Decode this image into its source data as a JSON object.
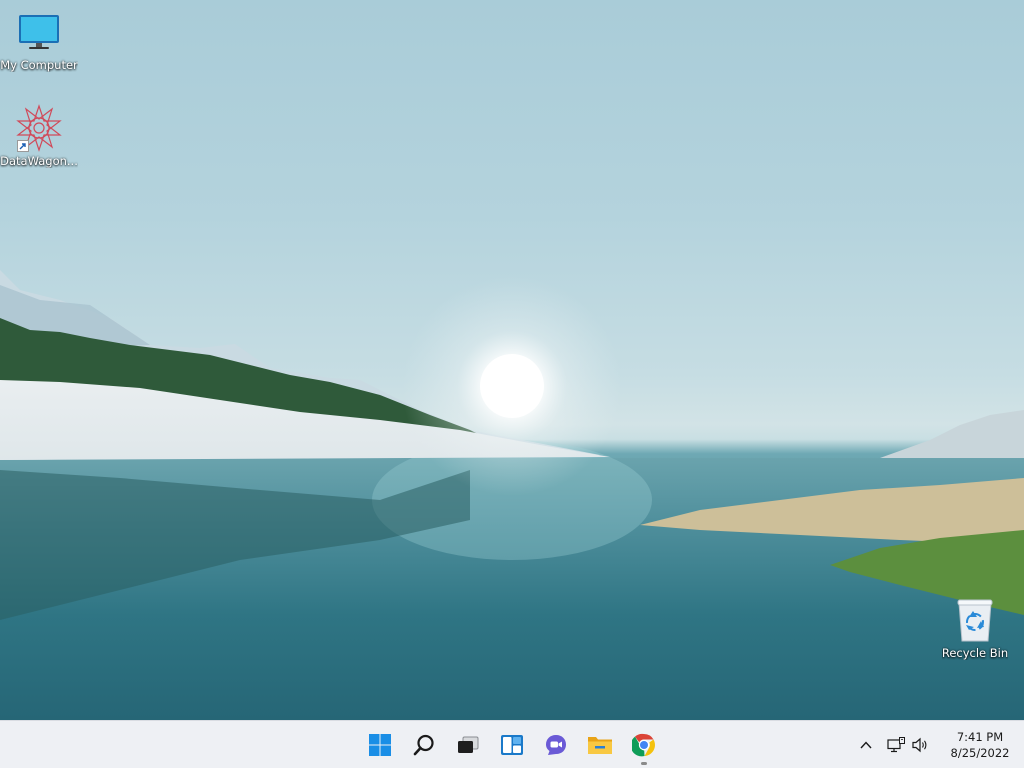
{
  "desktop": {
    "icons": [
      {
        "label": "My Computer",
        "icon": "monitor-icon"
      },
      {
        "label": "DataWagon...",
        "icon": "datawagon-logo-icon"
      },
      {
        "label": "Recycle Bin",
        "icon": "recycle-bin-icon"
      }
    ]
  },
  "taskbar": {
    "apps": [
      {
        "name": "Start",
        "icon": "windows-start-icon"
      },
      {
        "name": "Search",
        "icon": "search-icon"
      },
      {
        "name": "Task View",
        "icon": "task-view-icon"
      },
      {
        "name": "Widgets",
        "icon": "widgets-icon"
      },
      {
        "name": "Chat",
        "icon": "chat-icon"
      },
      {
        "name": "File Explorer",
        "icon": "folder-icon"
      },
      {
        "name": "Google Chrome",
        "icon": "chrome-icon"
      }
    ],
    "tray": {
      "icons": [
        "chevron-up-icon",
        "network-icon",
        "volume-icon"
      ],
      "time": "7:41 PM",
      "date": "8/25/2022"
    }
  },
  "colors": {
    "taskbar_bg": "#eef0f4",
    "accent": "#0067c0"
  }
}
